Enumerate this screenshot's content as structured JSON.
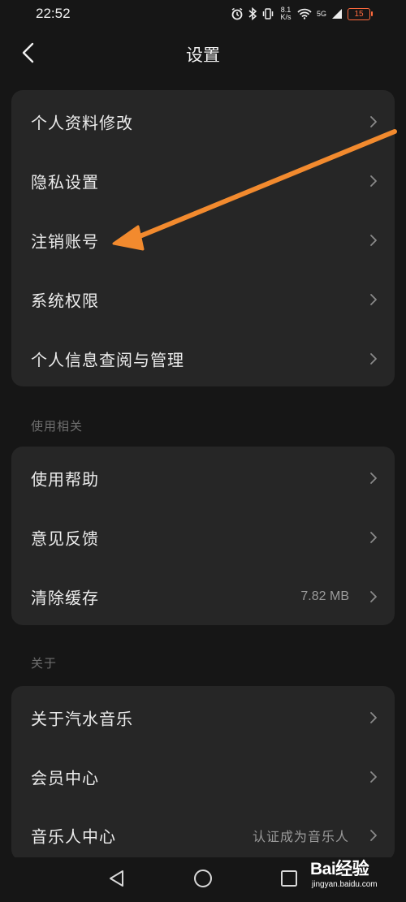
{
  "status_bar": {
    "time": "22:52",
    "net_speed_value": "8.1",
    "net_speed_unit": "K/s",
    "signal_label": "5G",
    "battery": "15"
  },
  "header": {
    "title": "设置"
  },
  "group1": {
    "items": [
      {
        "label": "个人资料修改"
      },
      {
        "label": "隐私设置"
      },
      {
        "label": "注销账号"
      },
      {
        "label": "系统权限"
      },
      {
        "label": "个人信息查阅与管理"
      }
    ]
  },
  "group2": {
    "title": "使用相关",
    "items": [
      {
        "label": "使用帮助"
      },
      {
        "label": "意见反馈"
      },
      {
        "label": "清除缓存",
        "value": "7.82 MB"
      }
    ]
  },
  "group3": {
    "title": "关于",
    "items": [
      {
        "label": "关于汽水音乐"
      },
      {
        "label": "会员中心"
      },
      {
        "label": "音乐人中心",
        "value": "认证成为音乐人"
      }
    ]
  },
  "watermark": {
    "brand": "Bai经验",
    "url": "jingyan.baidu.com"
  },
  "colors": {
    "background": "#161616",
    "card": "#262626",
    "annotation_arrow": "#f28a2e",
    "battery_low": "#ff6a3d"
  }
}
